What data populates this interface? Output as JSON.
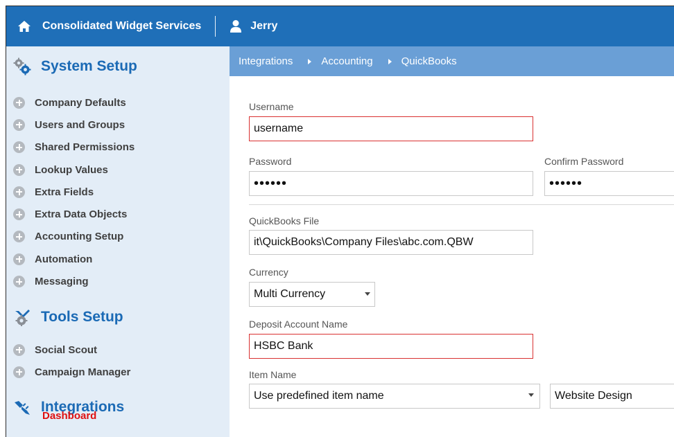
{
  "topbar": {
    "company": "Consolidated Widget Services",
    "user": "Jerry",
    "color": "#1f6fb8"
  },
  "sidebar": {
    "system_setup": {
      "title": "System Setup",
      "icon": "gears-icon",
      "items": [
        {
          "label": "Company Defaults"
        },
        {
          "label": "Users and Groups"
        },
        {
          "label": "Shared Permissions"
        },
        {
          "label": "Lookup Values"
        },
        {
          "label": "Extra Fields"
        },
        {
          "label": "Extra Data Objects"
        },
        {
          "label": "Accounting Setup"
        },
        {
          "label": "Automation"
        },
        {
          "label": "Messaging"
        }
      ]
    },
    "tools_setup": {
      "title": "Tools Setup",
      "icon": "tools-gear-icon",
      "items": [
        {
          "label": "Social Scout"
        },
        {
          "label": "Campaign Manager"
        }
      ]
    },
    "integrations": {
      "title": "Integrations",
      "icon": "plug-icon",
      "active_item": "Dashboard"
    }
  },
  "breadcrumb": [
    "Integrations",
    "Accounting",
    "QuickBooks"
  ],
  "form": {
    "username": {
      "label": "Username",
      "value": "username"
    },
    "password": {
      "label": "Password",
      "value": "••••••"
    },
    "confirm_password": {
      "label": "Confirm Password",
      "value": "••••••"
    },
    "quickbooks_file": {
      "label": "QuickBooks File",
      "value": "it\\QuickBooks\\Company Files\\abc.com.QBW"
    },
    "currency": {
      "label": "Currency",
      "value": "Multi Currency"
    },
    "deposit_account": {
      "label": "Deposit Account Name",
      "value": "HSBC Bank"
    },
    "item_name": {
      "label": "Item Name",
      "value": "Use predefined item name",
      "predefined_value": "Website Design"
    }
  }
}
